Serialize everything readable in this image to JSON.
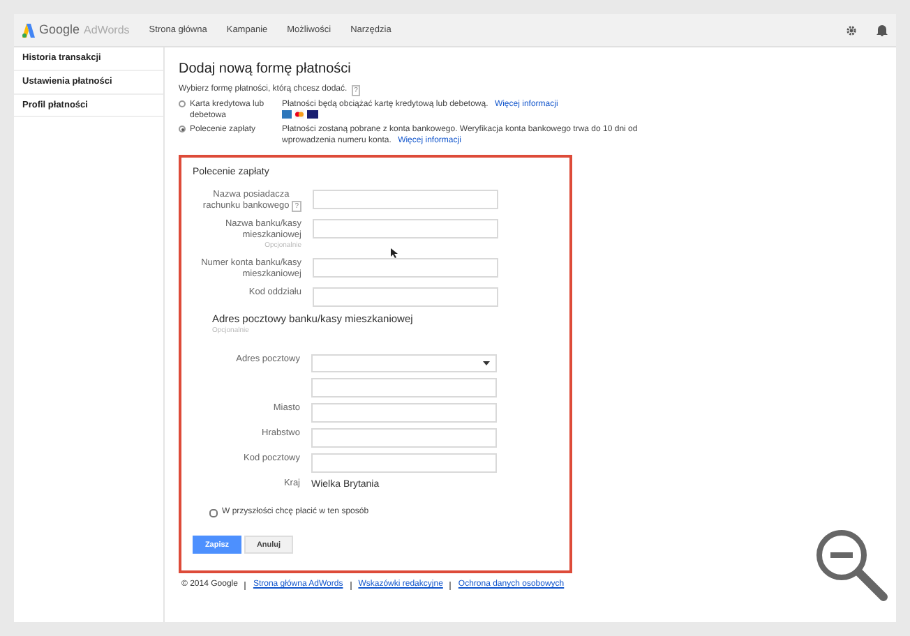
{
  "header": {
    "logo_text": "Google",
    "logo_product": "AdWords",
    "nav": [
      "Strona główna",
      "Kampanie",
      "Możliwości",
      "Narzędzia"
    ]
  },
  "sidebar": {
    "items": [
      "Historia transakcji",
      "Ustawienia płatności",
      "Profil płatności"
    ]
  },
  "title": "Dodaj nową formę płatności",
  "prompt": "Wybierz formę płatności, którą chcesz dodać.",
  "prompt_help": "?",
  "payment_options": [
    {
      "label": "Karta kredytowa lub debetowa",
      "description": "Płatności będą obciążać kartę kredytową lub debetową.",
      "link": "Więcej informacji",
      "cards": true,
      "selected": false
    },
    {
      "label": "Polecenie zapłaty",
      "description": "Płatności zostaną pobrane z konta bankowego. Weryfikacja konta bankowego trwa do 10 dni od wprowadzenia numeru konta.",
      "link": "Więcej informacji",
      "cards": false,
      "selected": true
    }
  ],
  "form": {
    "title": "Polecenie zapłaty",
    "fields": [
      {
        "kind": "input",
        "label": "Nazwa posiadacza rachunku bankowego",
        "help": "?"
      },
      {
        "kind": "input",
        "label": "Nazwa banku/kasy mieszkaniowej",
        "note": "Opcjonalnie"
      },
      {
        "kind": "input",
        "label": "Numer konta banku/kasy mieszkaniowej"
      },
      {
        "kind": "input",
        "label": "Kod oddziału"
      }
    ],
    "address_heading": "Adres pocztowy banku/kasy mieszkaniowej",
    "address_note": "Opcjonalnie",
    "address_fields": [
      {
        "kind": "select",
        "label": "Adres pocztowy"
      },
      {
        "kind": "input"
      },
      {
        "kind": "input",
        "label": "Miasto"
      },
      {
        "kind": "input",
        "label": "Hrabstwo"
      },
      {
        "kind": "input",
        "label": "Kod pocztowy"
      },
      {
        "kind": "static",
        "label": "Kraj",
        "value": "Wielka Brytania"
      }
    ],
    "checkbox": {
      "label": "W przyszłości chcę płacić w ten sposób",
      "checked": false
    },
    "buttons": [
      {
        "label": "Zapisz",
        "kind": "primary"
      },
      {
        "label": "Anuluj",
        "kind": "secondary"
      }
    ]
  },
  "footer": {
    "copyright": "© 2014 Google",
    "links": [
      "Strona główna AdWords",
      "Wskazówki redakcyjne",
      "Ochrona danych osobowych"
    ]
  }
}
